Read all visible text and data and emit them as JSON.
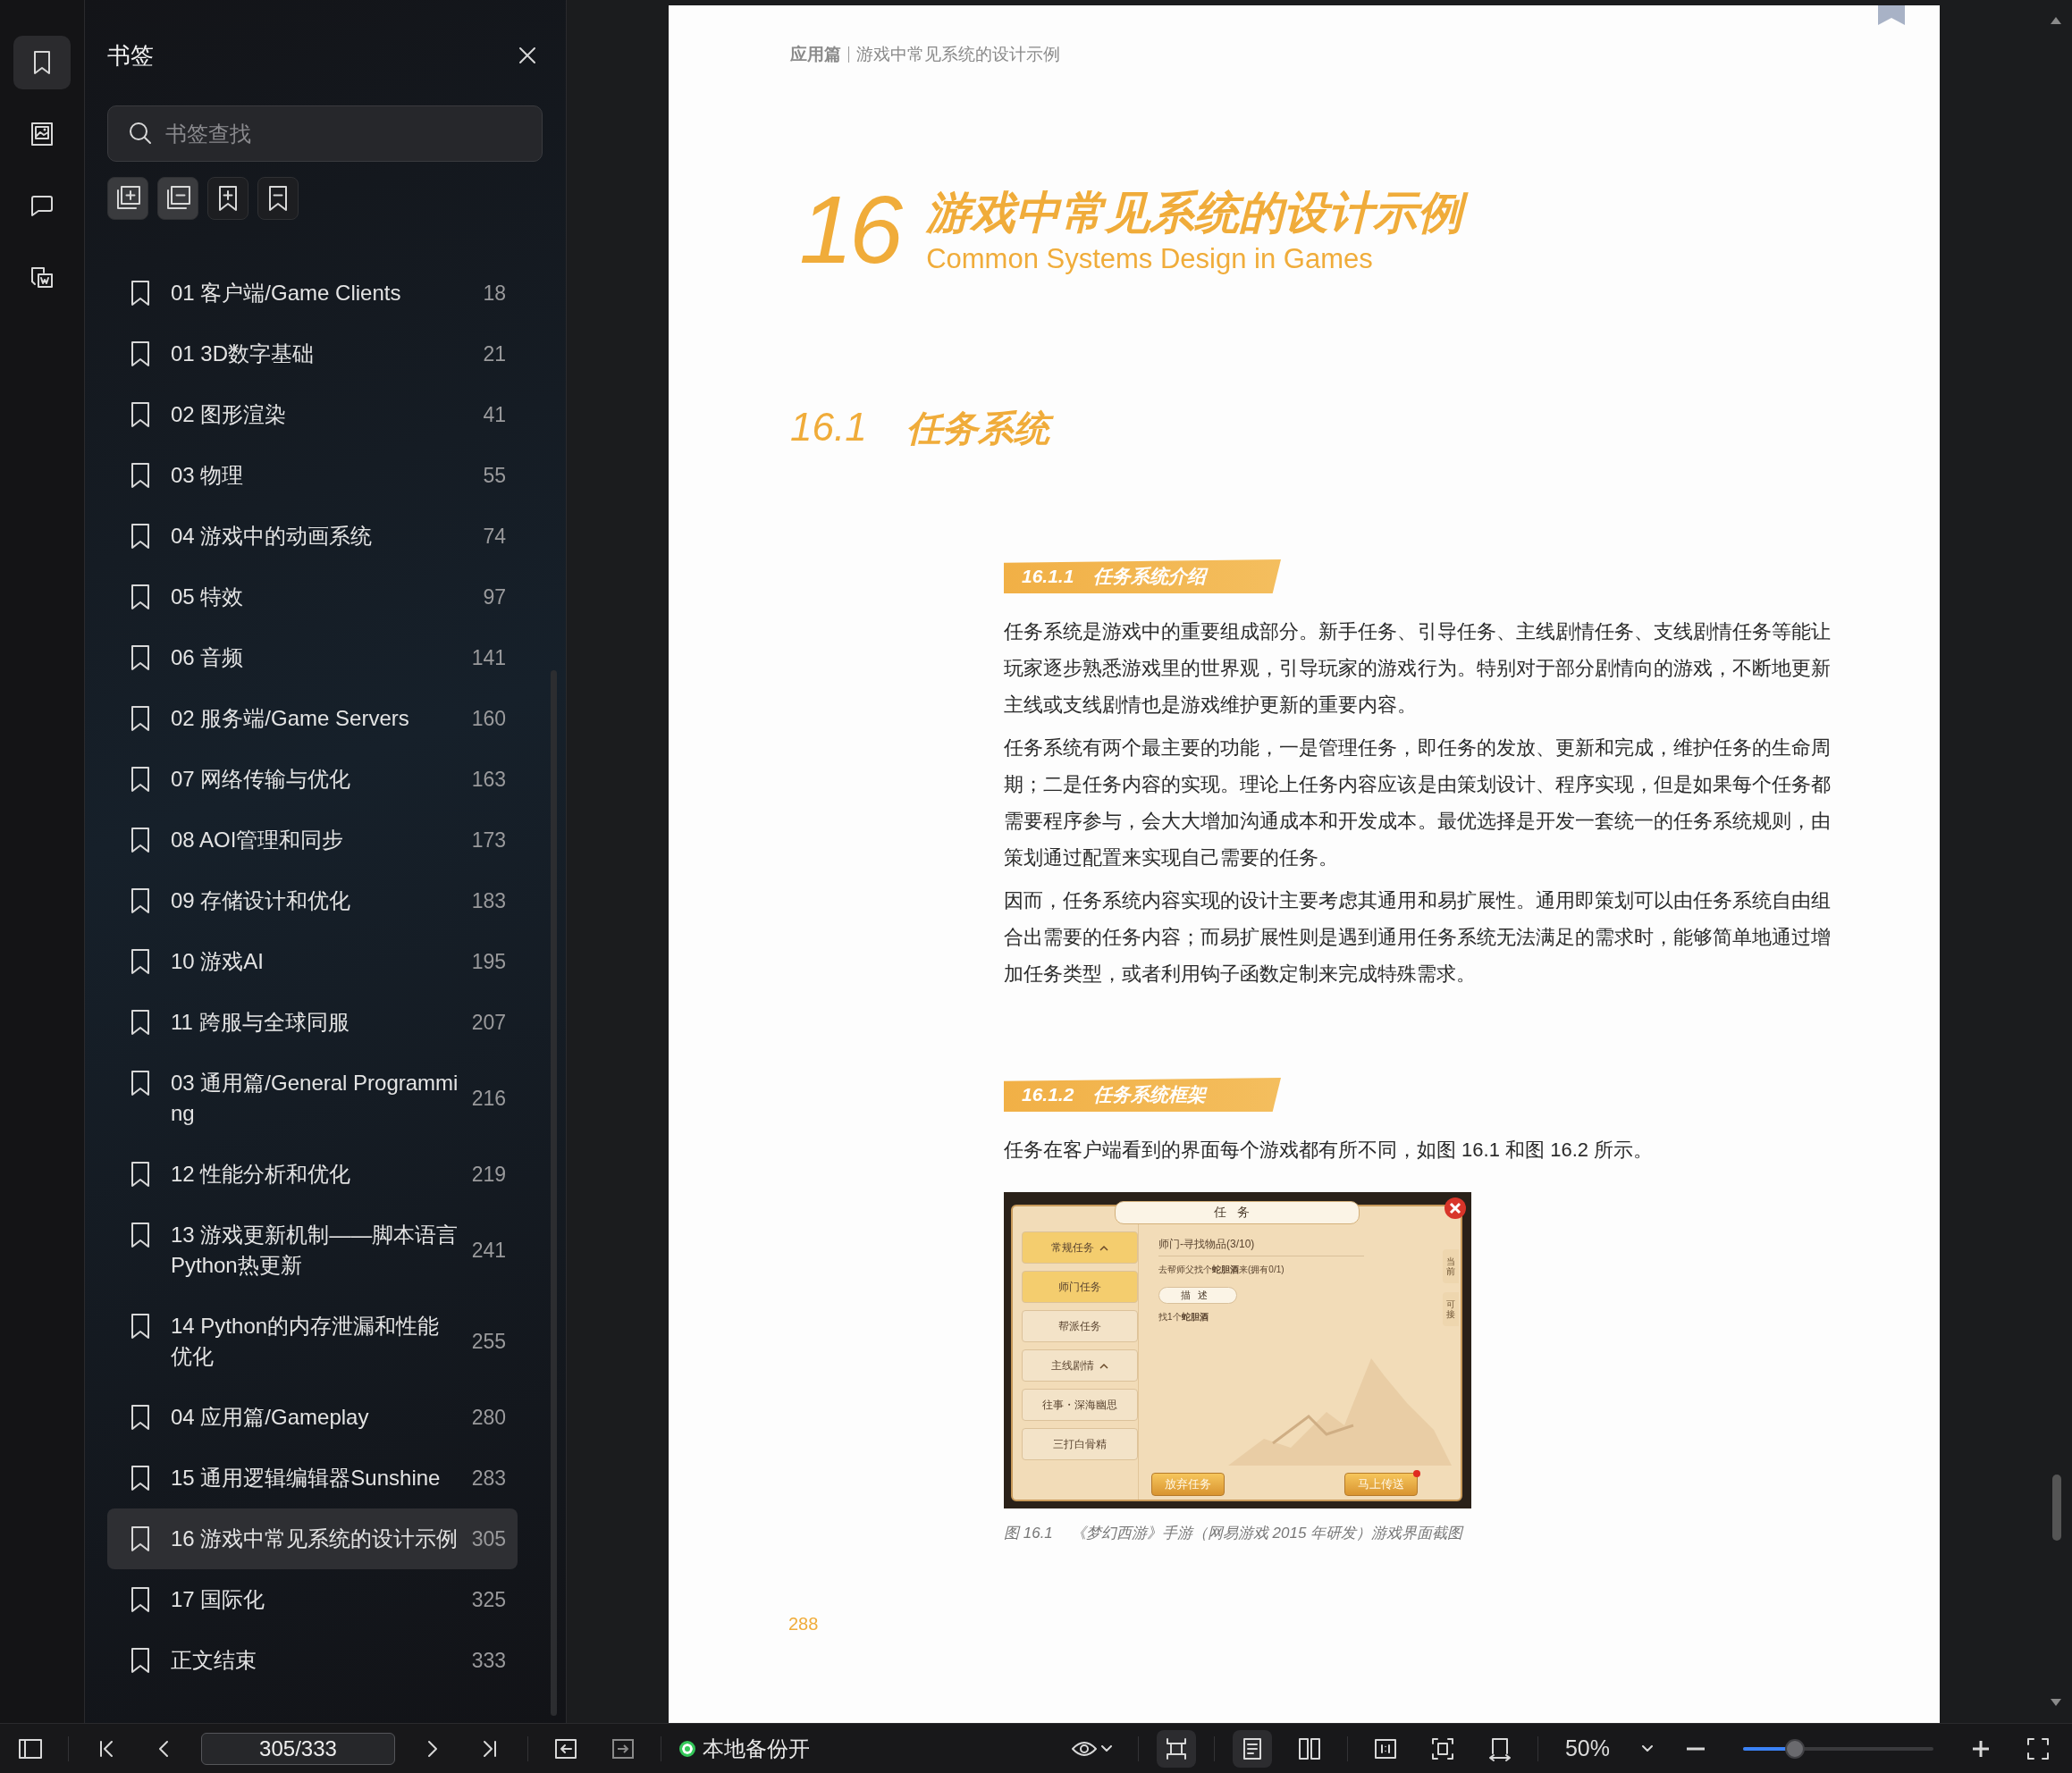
{
  "rail": [
    {
      "kind": "bookmarks",
      "selected": true
    },
    {
      "kind": "images",
      "selected": false
    },
    {
      "kind": "comments",
      "selected": false
    },
    {
      "kind": "export",
      "selected": false
    }
  ],
  "panel": {
    "title": "书签",
    "search": {
      "placeholder": "书签查找"
    },
    "tools": [
      {
        "kind": "expand_all",
        "active": true
      },
      {
        "kind": "collapse_all",
        "active": true
      },
      {
        "kind": "add_bookmark",
        "active": false
      },
      {
        "kind": "remove_bookmark",
        "active": false
      }
    ],
    "bookmarks": [
      {
        "label": "01 客户端/Game Clients",
        "page": "18",
        "selected": false
      },
      {
        "label": "01 3D数字基础",
        "page": "21",
        "selected": false
      },
      {
        "label": "02 图形渲染",
        "page": "41",
        "selected": false
      },
      {
        "label": "03 物理",
        "page": "55",
        "selected": false
      },
      {
        "label": "04 游戏中的动画系统",
        "page": "74",
        "selected": false
      },
      {
        "label": "05 特效",
        "page": "97",
        "selected": false
      },
      {
        "label": "06 音频",
        "page": "141",
        "selected": false
      },
      {
        "label": "02 服务端/Game Servers",
        "page": "160",
        "selected": false
      },
      {
        "label": "07 网络传输与优化",
        "page": "163",
        "selected": false
      },
      {
        "label": "08 AOI管理和同步",
        "page": "173",
        "selected": false
      },
      {
        "label": "09 存储设计和优化",
        "page": "183",
        "selected": false
      },
      {
        "label": "10 游戏AI",
        "page": "195",
        "selected": false
      },
      {
        "label": "11 跨服与全球同服",
        "page": "207",
        "selected": false
      },
      {
        "label": "03 通用篇/General Programming",
        "page": "216",
        "selected": false
      },
      {
        "label": "12 性能分析和优化",
        "page": "219",
        "selected": false
      },
      {
        "label": "13 游戏更新机制——脚本语言Python热更新",
        "page": "241",
        "selected": false
      },
      {
        "label": "14 Python的内存泄漏和性能优化",
        "page": "255",
        "selected": false
      },
      {
        "label": "04 应用篇/Gameplay",
        "page": "280",
        "selected": false
      },
      {
        "label": "15 通用逻辑编辑器Sunshine",
        "page": "283",
        "selected": false
      },
      {
        "label": "16 游戏中常见系统的设计示例",
        "page": "305",
        "selected": true
      },
      {
        "label": "17 国际化",
        "page": "325",
        "selected": false
      },
      {
        "label": "正文结束",
        "page": "333",
        "selected": false
      }
    ]
  },
  "document": {
    "bookmarked": true,
    "running_header": {
      "part": "应用篇",
      "chapter": "游戏中常见系统的设计示例"
    },
    "chapter_number": "16",
    "chapter_title": "游戏中常见系统的设计示例",
    "chapter_subtitle": "Common Systems Design in Games",
    "section": {
      "number": "16.1",
      "title": "任务系统"
    },
    "subsections": [
      {
        "number": "16.1.1",
        "title": "任务系统介绍",
        "paragraphs": [
          "任务系统是游戏中的重要组成部分。新手任务、引导任务、主线剧情任务、支线剧情任务等能让玩家逐步熟悉游戏里的世界观，引导玩家的游戏行为。特别对于部分剧情向的游戏，不断地更新主线或支线剧情也是游戏维护更新的重要内容。",
          "任务系统有两个最主要的功能，一是管理任务，即任务的发放、更新和完成，维护任务的生命周期；二是任务内容的实现。理论上任务内容应该是由策划设计、程序实现，但是如果每个任务都需要程序参与，会大大增加沟通成本和开发成本。最优选择是开发一套统一的任务系统规则，由策划通过配置来实现自己需要的任务。",
          "因而，任务系统内容实现的设计主要考虑其通用和易扩展性。通用即策划可以由任务系统自由组合出需要的任务内容；而易扩展性则是遇到通用任务系统无法满足的需求时，能够简单地通过增加任务类型，或者利用钩子函数定制来完成特殊需求。"
        ]
      },
      {
        "number": "16.1.2",
        "title": "任务系统框架",
        "paragraphs": [
          "任务在客户端看到的界面每个游戏都有所不同，如图 16.1 和图 16.2 所示。"
        ],
        "figure": {
          "title": "任务",
          "tabs": [
            {
              "kind": "group",
              "label": "常规任务",
              "selected": true
            },
            {
              "kind": "item",
              "label": "师门任务",
              "selected": true
            },
            {
              "kind": "item",
              "label": "帮派任务",
              "selected": false
            },
            {
              "kind": "group",
              "label": "主线剧情",
              "selected": false
            },
            {
              "kind": "item",
              "label": "往事・深海幽思",
              "selected": false
            },
            {
              "kind": "item",
              "label": "三打白骨精",
              "selected": false
            }
          ],
          "quest_title": "师门-寻找物品(3/10)",
          "quest_goal": "去帮师父找个**蛇胆酒**来(拥有0/1)",
          "description_label": "描述",
          "description": "找1个**蛇胆酒**",
          "side_tabs": [
            "当前",
            "可接"
          ],
          "buttons": [
            "放弃任务",
            "马上传送"
          ],
          "label": "图 16.1",
          "caption": "《梦幻西游》手游（网易游戏 2015 年研发）游戏界面截图"
        }
      }
    ],
    "page_number": "288"
  },
  "toolbar": {
    "page_field": "305/333",
    "backup": {
      "label": "本地备份开",
      "on": true
    },
    "scroll_mode": {
      "on": true
    },
    "page_layouts": [
      {
        "kind": "single",
        "selected": true
      },
      {
        "kind": "double",
        "selected": false
      }
    ],
    "zoom": "50%",
    "zoom_slider": {
      "level": 0.27
    }
  }
}
